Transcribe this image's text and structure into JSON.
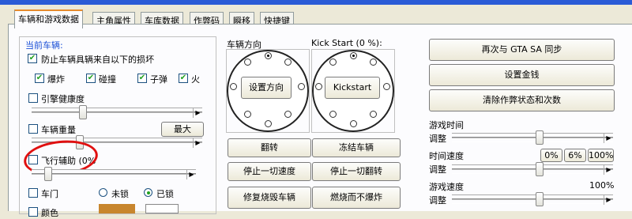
{
  "tabs": [
    {
      "label": "车辆和游戏数据",
      "active": true
    },
    {
      "label": "主角属性"
    },
    {
      "label": "车库数据"
    },
    {
      "label": "作弊码"
    },
    {
      "label": "瞬移"
    },
    {
      "label": "快捷键"
    }
  ],
  "left": {
    "current_vehicle_label": "当前车辆:",
    "protect_label": "防止车辆具辆来自以下的损坏",
    "damage_types": [
      {
        "label": "爆炸",
        "checked": true
      },
      {
        "label": "碰撞",
        "checked": true
      },
      {
        "label": "子弹",
        "checked": true
      },
      {
        "label": "火",
        "checked": true
      }
    ],
    "engine_health_label": "引擎健康度",
    "vehicle_weight_label": "车辆重量",
    "max_button": "最大",
    "flight_assist_label": "飞行辅助 (0%",
    "doors_label": "车门",
    "unlocked_label": "未锁",
    "locked_label": "已锁",
    "color_label": "颜色"
  },
  "middle": {
    "direction_title": "车辆方向",
    "kickstart_title": "Kick Start (0 %):",
    "set_direction_button": "设置方向",
    "kickstart_button": "Kickstart",
    "flip_button": "翻转",
    "freeze_button": "冻结车辆",
    "stop_speed_button": "停止一切速度",
    "stop_flip_button": "停止一切翻转",
    "repair_button": "修复烧毁车辆",
    "burn_no_explode_button": "燃烧而不爆炸"
  },
  "right": {
    "sync_button": "再次与 GTA SA 同步",
    "set_money_button": "设置金钱",
    "clear_cheat_button": "清除作弊状态和次数",
    "game_time_label": "游戏时间",
    "adjust_label": "调整",
    "time_speed_label": "时间速度",
    "speed_presets": [
      "0%",
      "6%",
      "100%"
    ],
    "game_speed_label": "游戏速度",
    "game_speed_value": "100%"
  },
  "colors": {
    "accent_tab": "#e68b2c",
    "check": "#21a121",
    "annotation": "#e01010",
    "color_swatch": "#c8862e"
  }
}
